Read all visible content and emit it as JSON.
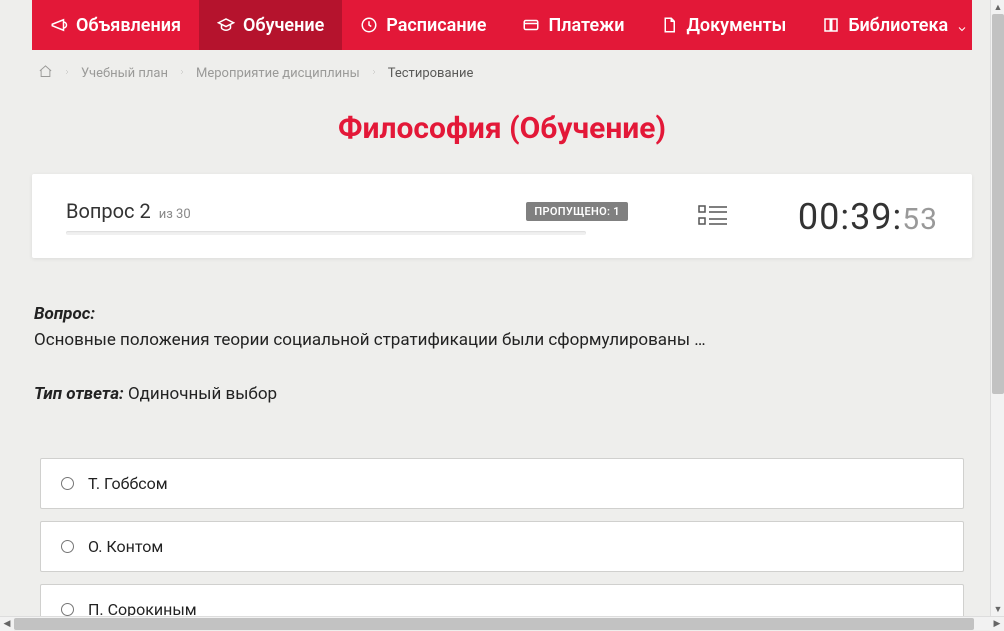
{
  "nav": {
    "items": [
      {
        "label": "Объявления",
        "icon": "megaphone"
      },
      {
        "label": "Обучение",
        "icon": "graduation",
        "active": true
      },
      {
        "label": "Расписание",
        "icon": "clock"
      },
      {
        "label": "Платежи",
        "icon": "card"
      },
      {
        "label": "Документы",
        "icon": "document"
      },
      {
        "label": "Библиотека",
        "icon": "book",
        "dropdown": true
      }
    ]
  },
  "breadcrumb": {
    "items": [
      {
        "label": "Учебный план"
      },
      {
        "label": "Мероприятие дисциплины"
      },
      {
        "label": "Тестирование",
        "current": true
      }
    ]
  },
  "page_title": "Философия (Обучение)",
  "status": {
    "question_label": "Вопрос 2",
    "of_label": "из 30",
    "skipped_label": "ПРОПУЩЕНО: 1",
    "timer_main": "00:39:",
    "timer_sec": "53"
  },
  "question": {
    "label": "Вопрос:",
    "text": "Основные положения теории социальной стратификации были сформулированы …",
    "answer_type_label": "Тип ответа:",
    "answer_type_value": "Одиночный выбор"
  },
  "options": [
    {
      "label": "Т. Гоббсом"
    },
    {
      "label": "О. Контом"
    },
    {
      "label": "П. Сорокиным"
    }
  ]
}
